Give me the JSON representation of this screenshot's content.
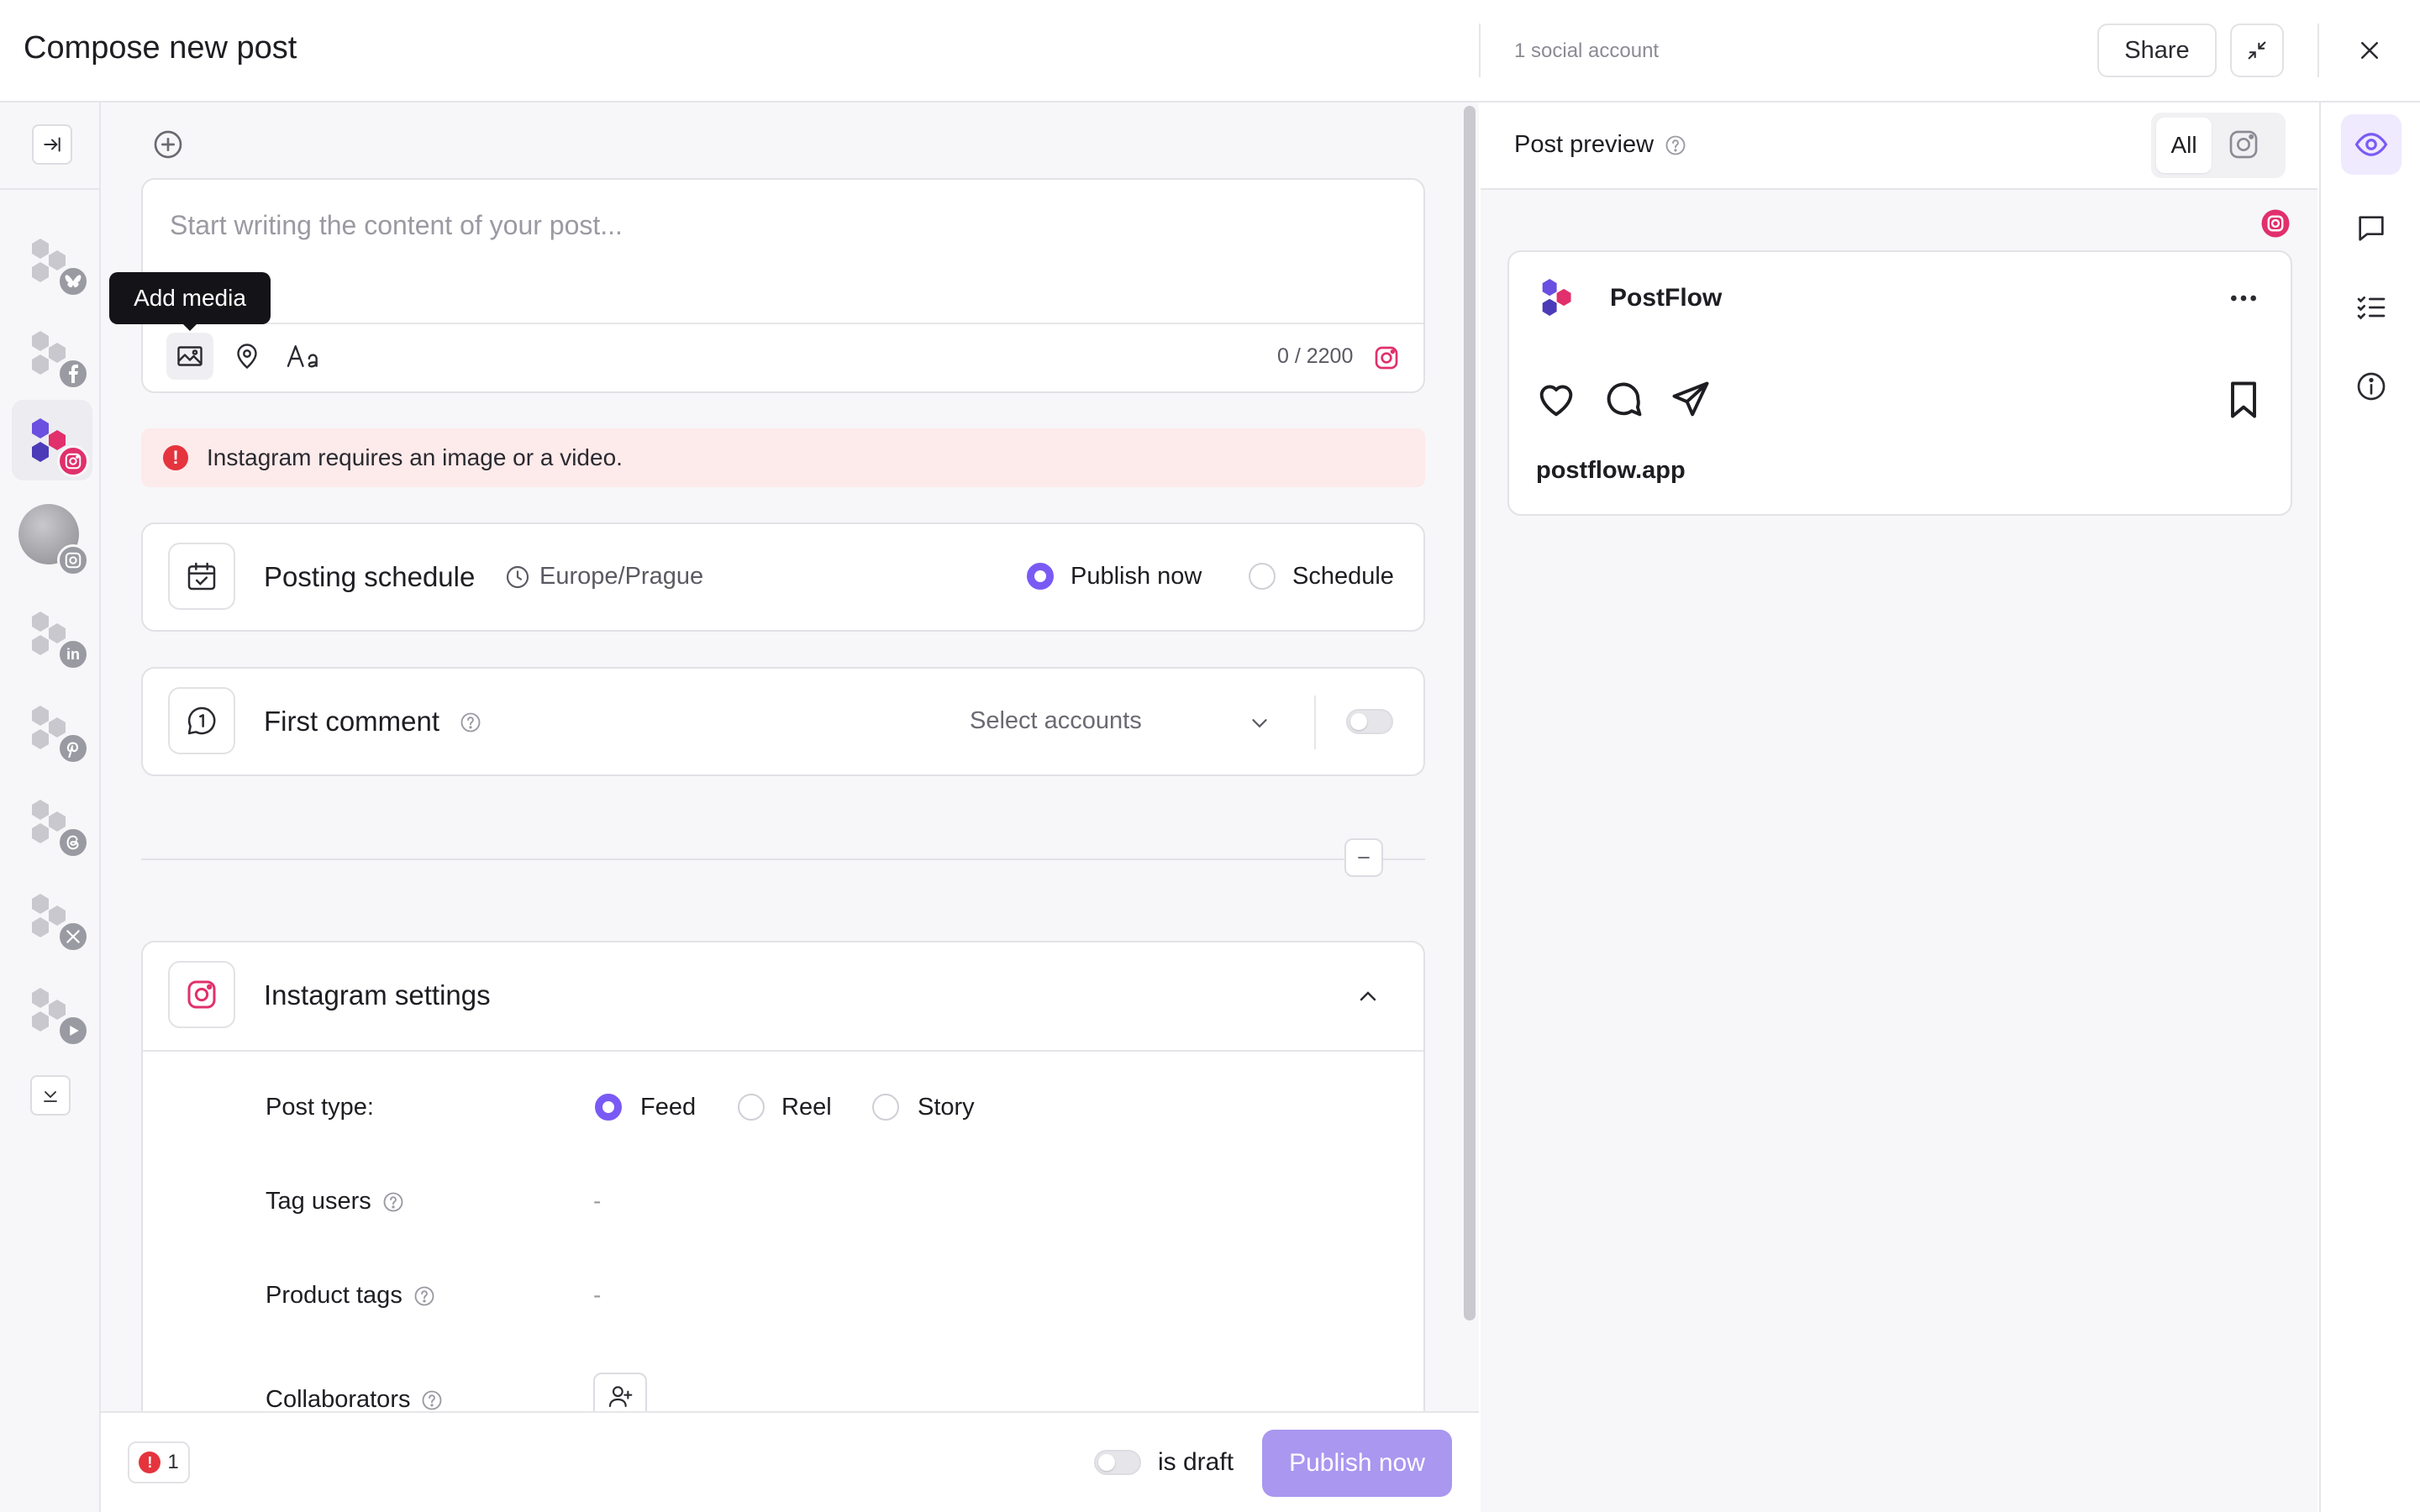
{
  "header": {
    "title": "Compose new post",
    "account_count": "1 social account",
    "share_label": "Share"
  },
  "composer": {
    "placeholder": "Start writing the content of your post...",
    "tooltip": "Add media",
    "char_count": "0 / 2200"
  },
  "alert": {
    "text": "Instagram requires an image or a video."
  },
  "schedule": {
    "title": "Posting schedule",
    "timezone": "Europe/Prague",
    "options": [
      "Publish now",
      "Schedule"
    ],
    "selected": "Publish now"
  },
  "first_comment": {
    "title": "First comment",
    "select_placeholder": "Select accounts"
  },
  "instagram_settings": {
    "title": "Instagram settings",
    "post_type_label": "Post type:",
    "post_types": [
      "Feed",
      "Reel",
      "Story"
    ],
    "selected_post_type": "Feed",
    "tag_users_label": "Tag users",
    "tag_users_value": "-",
    "product_tags_label": "Product tags",
    "product_tags_value": "-",
    "collaborators_label": "Collaborators"
  },
  "footer": {
    "error_count": "1",
    "draft_label": "is draft",
    "publish_label": "Publish now"
  },
  "preview": {
    "title": "Post preview",
    "filter_all": "All",
    "account_name": "PostFlow",
    "link_text": "postflow.app"
  },
  "colors": {
    "accent": "#7a5af5",
    "accent_light": "#a997f0",
    "instagram": "#e1306c",
    "error": "#e5343d",
    "alert_bg": "#fdeaea"
  },
  "sidebar": {
    "accounts": [
      {
        "network": "bluesky-icon"
      },
      {
        "network": "facebook-icon"
      },
      {
        "network": "instagram-icon",
        "active": true
      },
      {
        "network": "instagram-icon",
        "avatar": true
      },
      {
        "network": "linkedin-icon"
      },
      {
        "network": "pinterest-icon"
      },
      {
        "network": "threads-icon"
      },
      {
        "network": "x-icon"
      },
      {
        "network": "youtube-icon"
      }
    ]
  }
}
